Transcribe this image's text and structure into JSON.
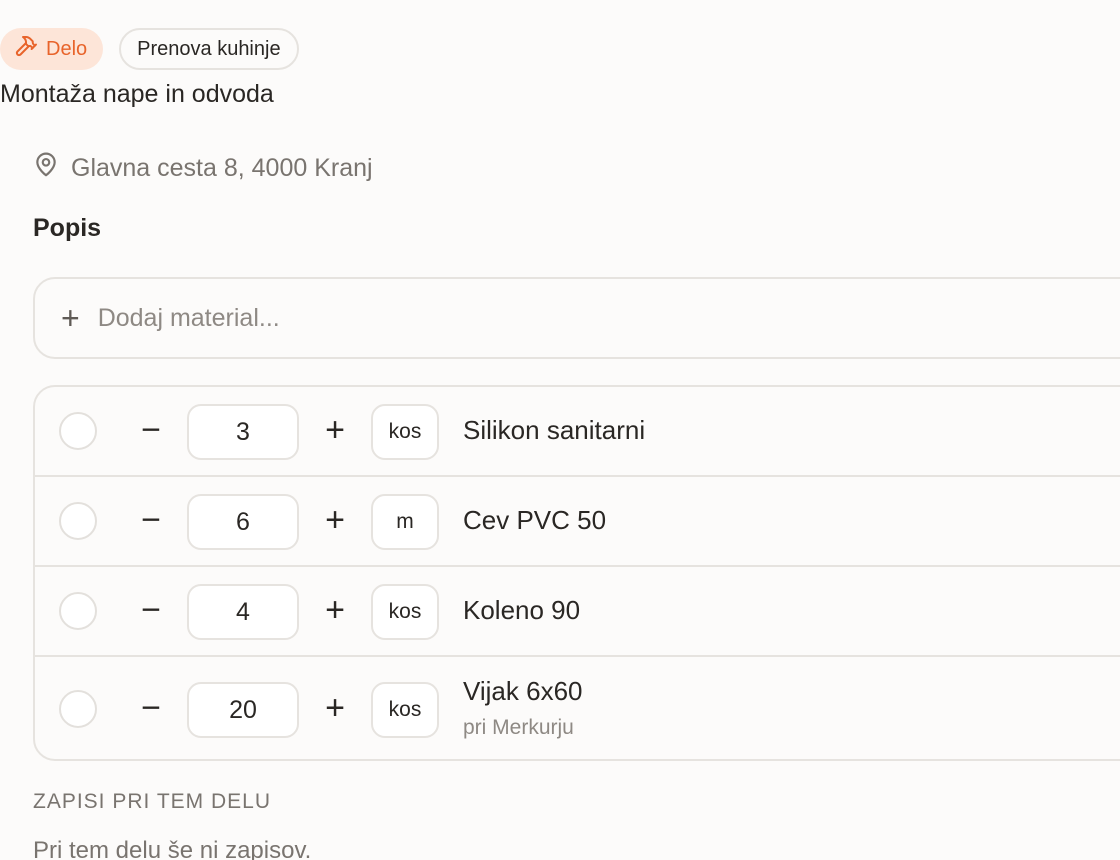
{
  "header": {
    "work_chip": "Delo",
    "project_chip": "Prenova kuhinje",
    "title": "Montaža nape in odvoda",
    "address": "Glavna cesta 8, 4000 Kranj"
  },
  "description": {
    "label": "Popis",
    "add_placeholder": "Dodaj material..."
  },
  "materials": [
    {
      "qty": "3",
      "unit": "kos",
      "name": "Silikon sanitarni",
      "note": ""
    },
    {
      "qty": "6",
      "unit": "m",
      "name": "Cev PVC 50",
      "note": ""
    },
    {
      "qty": "4",
      "unit": "kos",
      "name": "Koleno 90",
      "note": ""
    },
    {
      "qty": "20",
      "unit": "kos",
      "name": "Vijak 6x60",
      "note": "pri Merkurju"
    }
  ],
  "notes": {
    "label": "ZAPISI PRI TEM DELU",
    "empty": "Pri tem delu še ni zapisov."
  },
  "colors": {
    "accent": "#e8642b",
    "accent_bg": "#fde5d8",
    "border": "#e6e3df",
    "background": "#fcfbfa"
  }
}
